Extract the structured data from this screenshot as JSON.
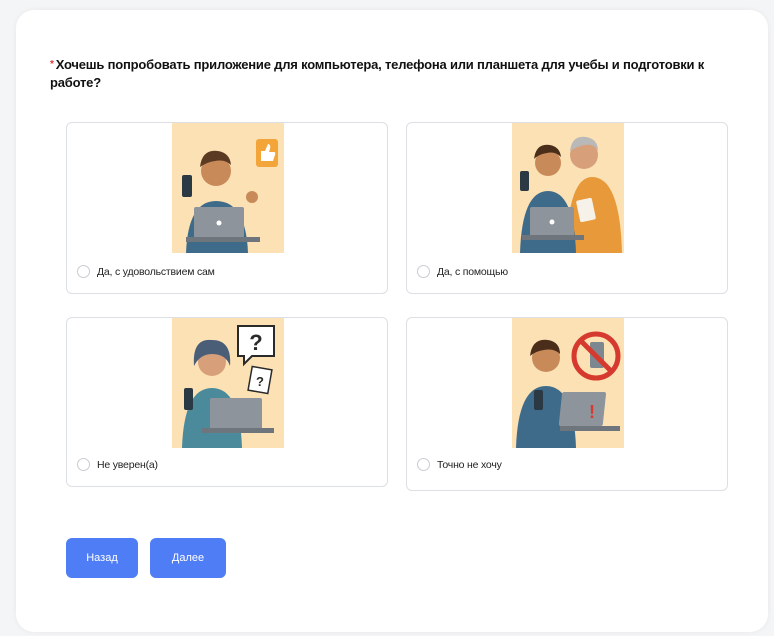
{
  "question": {
    "required_mark": "*",
    "text": "Хочешь попробовать приложение для компьютера, телефона или планшета для учебы и подготовки к работе?"
  },
  "options": [
    {
      "label": "Да, с удовольствием сам",
      "image_icon": "thumbs-up-person-laptop"
    },
    {
      "label": "Да, с помощью",
      "image_icon": "person-with-helper-laptop"
    },
    {
      "label": "Не уверен(а)",
      "image_icon": "question-person-laptop"
    },
    {
      "label": "Точно не хочу",
      "image_icon": "no-phone-person-laptop"
    }
  ],
  "buttons": {
    "back": "Назад",
    "next": "Далее"
  },
  "colors": {
    "accent": "#4f7df5",
    "required": "#e03a3a",
    "illustration_bg": "#fbe1b4"
  }
}
